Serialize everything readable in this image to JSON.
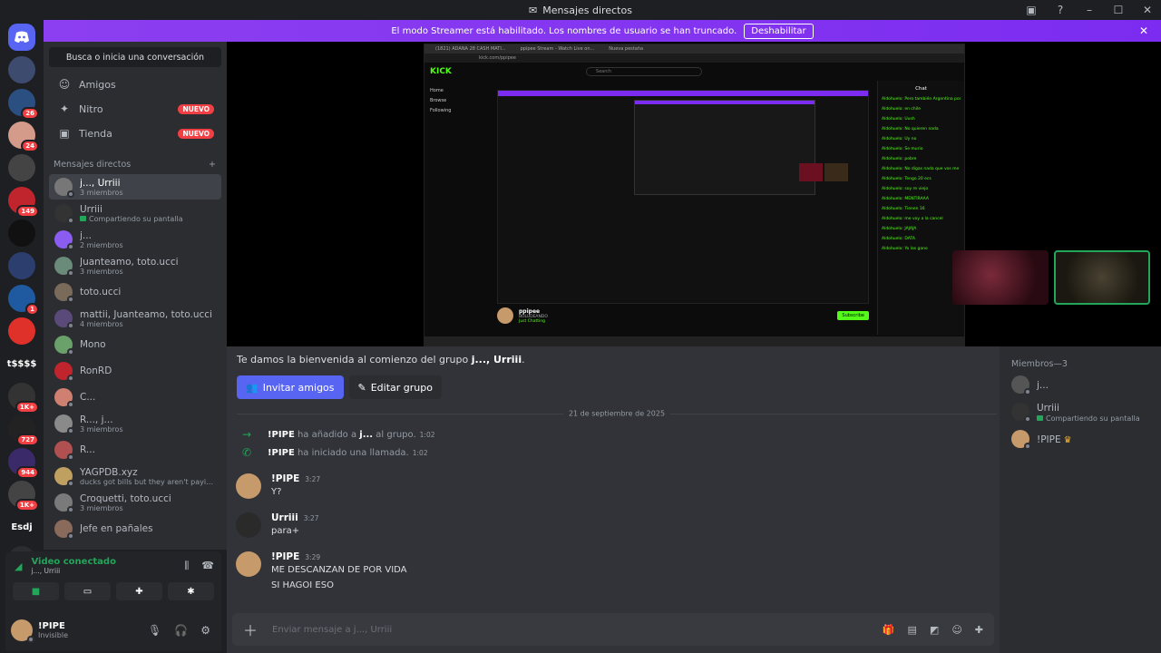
{
  "window": {
    "title": "Mensajes directos"
  },
  "banner": {
    "text": "El modo Streamer está habilitado. Los nombres de usuario se han truncado.",
    "button": "Deshabilitar"
  },
  "guilds": [
    {
      "badge": "",
      "color": "#3c4b6e"
    },
    {
      "badge": "26",
      "color": "#2a4f80"
    },
    {
      "badge": "24",
      "color": "#d49a8a"
    },
    {
      "badge": "",
      "color": "#444444"
    },
    {
      "badge": "149",
      "color": "#c0242c"
    },
    {
      "badge": "",
      "color": "#111111"
    },
    {
      "badge": "",
      "color": "#2c3e6e"
    },
    {
      "badge": "1",
      "color": "#1f5aa0"
    },
    {
      "badge": "",
      "color": "#e0302a"
    },
    {
      "text": "t$$$$",
      "badge": "",
      "color": "transparent"
    },
    {
      "badge": "1K+",
      "color": "#333333"
    },
    {
      "badge": "727",
      "color": "#222222"
    },
    {
      "badge": "944",
      "color": "#3a2a6a"
    },
    {
      "badge": "1K+",
      "color": "#444444"
    },
    {
      "text": "Esdj",
      "badge": "",
      "color": "transparent"
    }
  ],
  "sidebar": {
    "search": "Busca o inicia una conversación",
    "nav": [
      {
        "label": "Amigos",
        "icon": "☺",
        "badge": ""
      },
      {
        "label": "Nitro",
        "icon": "✦",
        "badge": "NUEVO"
      },
      {
        "label": "Tienda",
        "icon": "▣",
        "badge": "NUEVO"
      }
    ],
    "dm_header": "Mensajes directos",
    "dms": [
      {
        "name": "j..., Urriii",
        "sub": "3 miembros",
        "share": false,
        "color": "#777777",
        "active": true
      },
      {
        "name": "Urriii",
        "sub": "Compartiendo su pantalla",
        "share": true,
        "color": "#333333",
        "active": false
      },
      {
        "name": "j...",
        "sub": "2 miembros",
        "share": false,
        "color": "#8a5cf0",
        "active": false
      },
      {
        "name": "Juanteamo, toto.ucci",
        "sub": "3 miembros",
        "share": false,
        "color": "#6a8a7a",
        "active": false
      },
      {
        "name": "toto.ucci",
        "sub": "",
        "share": false,
        "color": "#7a6a5a",
        "active": false
      },
      {
        "name": "mattii, Juanteamo, toto.ucci",
        "sub": "4 miembros",
        "share": false,
        "color": "#5a4a7a",
        "active": false
      },
      {
        "name": "Mono",
        "sub": "",
        "share": false,
        "color": "#6aa06a",
        "active": false
      },
      {
        "name": "RonRD",
        "sub": "",
        "share": false,
        "color": "#c0242c",
        "active": false
      },
      {
        "name": "C...",
        "sub": "",
        "share": false,
        "color": "#d08070",
        "active": false
      },
      {
        "name": "R..., j...",
        "sub": "3 miembros",
        "share": false,
        "color": "#8a8a8a",
        "active": false
      },
      {
        "name": "R...",
        "sub": "",
        "share": false,
        "color": "#b05050",
        "active": false
      },
      {
        "name": "YAGPDB.xyz",
        "sub": "ducks got bills but they aren't paying for ...",
        "share": false,
        "color": "#c0a060",
        "active": false
      },
      {
        "name": "Croquetti, toto.ucci",
        "sub": "3 miembros",
        "share": false,
        "color": "#7a7a7a",
        "active": false
      },
      {
        "name": "Jefe en pañales",
        "sub": "",
        "share": false,
        "color": "#8a6a5a",
        "active": false
      }
    ]
  },
  "voice": {
    "title": "Video conectado",
    "sub": "j..., Urriii"
  },
  "user": {
    "name": "!PIPE",
    "status": "Invisible"
  },
  "stream": {
    "kick_tabs": [
      "(1821) ADANA 28 CASH MATI...",
      "ppipee Stream - Watch Live on...",
      "Nueva pestaña"
    ],
    "kick_url": "kick.com/ppipee",
    "kick_logo": "KICK",
    "kick_search": "Search",
    "kick_nav": [
      "Home",
      "Browse",
      "Following"
    ],
    "kick_chat_title": "Chat",
    "kick_chat": [
      "Aldohuelo: Pero también Argentina por parte de papá",
      "Aldohuelo: en chile",
      "Aldohuelo: Uush",
      "Aldohuelo: No quieren nada",
      "Aldohuelo: Uy no",
      "Aldohuelo: Se murio",
      "Aldohuelo: pobre",
      "Aldohuelo: No digas nada que vos me quieres banear",
      "Aldohuelo: Tengo 20 ecs",
      "Aldohuelo: soy re viejo",
      "Aldohuelo: MENTIRAAA",
      "Aldohuelo: Tienen 16",
      "Aldohuelo: me voy a la cancel",
      "Aldohuelo: JAJAJA",
      "Aldohuelo: DATA",
      "Aldohuelo: Yo las gano"
    ],
    "kick_channel": "ppipee",
    "kick_channel_sub": "BOLUDEANDO",
    "kick_category": "Just Chatting",
    "kick_subscribe": "Subscribe"
  },
  "chat": {
    "welcome_prefix": "Te damos la bienvenida al comienzo del grupo ",
    "welcome_group": "j..., Urriii",
    "invite": "Invitar amigos",
    "edit": "Editar grupo",
    "date": "21 de septiembre de 2025",
    "system": [
      {
        "icon": "→",
        "user": "!PIPE",
        "text": " ha añadido a ",
        "target": "j...",
        "tail": " al grupo.",
        "time": "1:02"
      },
      {
        "icon": "✆",
        "user": "!PIPE",
        "text": " ha iniciado una llamada.",
        "target": "",
        "tail": "",
        "time": "1:02"
      }
    ],
    "messages": [
      {
        "name": "!PIPE",
        "time": "3:27",
        "lines": [
          "Y?"
        ],
        "color": "#c69a6a"
      },
      {
        "name": "Urriii",
        "time": "3:27",
        "lines": [
          "para+"
        ],
        "color": "#2a2a2a"
      },
      {
        "name": "!PIPE",
        "time": "3:29",
        "lines": [
          "ME DESCANZAN DE POR VIDA",
          "SI HAGOI ESO"
        ],
        "color": "#c69a6a"
      }
    ],
    "placeholder": "Enviar mensaje a j..., Urriii"
  },
  "members": {
    "header": "Miembros—3",
    "list": [
      {
        "name": "j...",
        "sub": "",
        "share": false,
        "color": "#555555",
        "crown": ""
      },
      {
        "name": "Urriii",
        "sub": "Compartiendo su pantalla",
        "share": true,
        "color": "#333333",
        "crown": ""
      },
      {
        "name": "!PIPE",
        "sub": "",
        "share": false,
        "color": "#c69a6a",
        "crown": "♛"
      }
    ]
  }
}
